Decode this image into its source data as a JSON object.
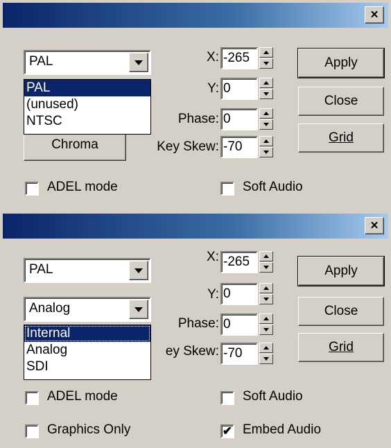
{
  "window1": {
    "close_glyph": "×",
    "standard_combo": {
      "value": "PAL"
    },
    "standard_dropdown": {
      "options": [
        "PAL",
        "(unused)",
        "NTSC"
      ],
      "selected": "PAL"
    },
    "chroma_button": "Chroma",
    "labels": {
      "x": "X:",
      "y": "Y:",
      "phase": "Phase:",
      "key_skew": "Key Skew:"
    },
    "values": {
      "x": "-265",
      "y": "0",
      "phase": "0",
      "key_skew": "-70"
    },
    "buttons": {
      "apply": "Apply",
      "close": "Close",
      "grid": "Grid"
    },
    "checkboxes": {
      "adel_mode": {
        "label": "ADEL mode",
        "checked": false
      },
      "soft_audio": {
        "label": "Soft Audio",
        "checked": false
      }
    }
  },
  "window2": {
    "close_glyph": "×",
    "standard_combo": {
      "value": "PAL"
    },
    "source_combo": {
      "value": "Analog"
    },
    "source_dropdown": {
      "options": [
        "Internal",
        "Analog",
        "SDI"
      ],
      "selected": "Internal"
    },
    "labels": {
      "x": "X:",
      "y": "Y:",
      "phase": "Phase:",
      "key_skew": "ey Skew:"
    },
    "values": {
      "x": "-265",
      "y": "0",
      "phase": "0",
      "key_skew": "-70"
    },
    "buttons": {
      "apply": "Apply",
      "close": "Close",
      "grid": "Grid"
    },
    "checkboxes": {
      "adel_mode": {
        "label": "ADEL mode",
        "checked": false
      },
      "soft_audio": {
        "label": "Soft Audio",
        "checked": false
      },
      "graphics_only": {
        "label": "Graphics Only",
        "checked": false
      },
      "embed_audio": {
        "label": "Embed Audio",
        "checked": true,
        "mark": "✔"
      }
    }
  }
}
